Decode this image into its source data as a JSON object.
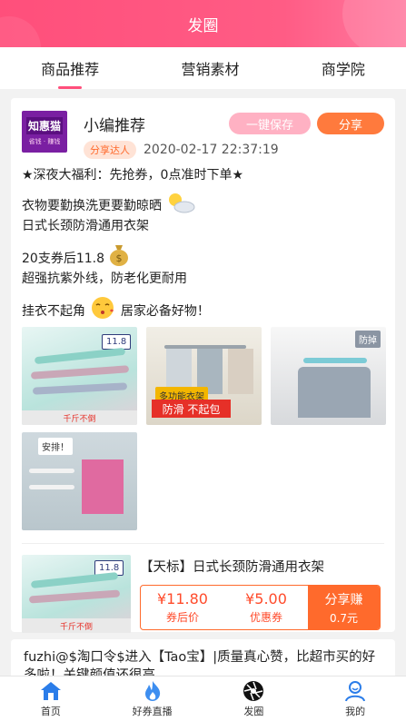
{
  "header": {
    "title": "发圈"
  },
  "tabs": [
    {
      "label": "商品推荐",
      "active": true
    },
    {
      "label": "营销素材",
      "active": false
    },
    {
      "label": "商学院",
      "active": false
    }
  ],
  "post": {
    "logo": {
      "main": "知惠猫",
      "sub": "省钱 · 赚钱"
    },
    "author": "小编推荐",
    "badge": "分享达人",
    "time": "2020-02-17 22:37:19",
    "save_label": "一键保存",
    "share_label": "分享",
    "lines": [
      "★深夜大福利：先抢券，0点准时下单★",
      "衣物要勤换洗更要勤晾晒",
      "日式长颈防滑通用衣架",
      "20支券后11.8",
      "超强抗紫外线，防老化更耐用",
      "挂衣不起角",
      "居家必备好物！"
    ],
    "images": {
      "img1_tag": "11.8",
      "img1_band": "千斤不倒",
      "img2_tag": "多功能衣架",
      "img2_band": "防滑 不起包",
      "img3_tag": "防掉",
      "img4_tag": "安排！"
    },
    "product": {
      "title": "【天标】日式长颈防滑通用衣架",
      "price_after": "¥11.80",
      "price_after_label": "券后价",
      "coupon": "¥5.00",
      "coupon_label": "优惠券",
      "share_earn": "分享赚",
      "earn_amount": "0.7元",
      "img_tag": "11.8",
      "img_band": "千斤不倒"
    }
  },
  "post2": {
    "text": "fuzhi@$淘口令$进入【Tao宝】|质量真心赞，比超市买的好多啦！关键颜值还很高，"
  },
  "bottom_nav": [
    {
      "label": "首页",
      "icon": "home-icon"
    },
    {
      "label": "好券直播",
      "icon": "flame-icon"
    },
    {
      "label": "发圈",
      "icon": "aperture-icon"
    },
    {
      "label": "我的",
      "icon": "user-icon"
    }
  ],
  "colors": {
    "brand": "#ff4f7b",
    "accent": "#ff6a2c",
    "price": "#ff4b2b"
  }
}
